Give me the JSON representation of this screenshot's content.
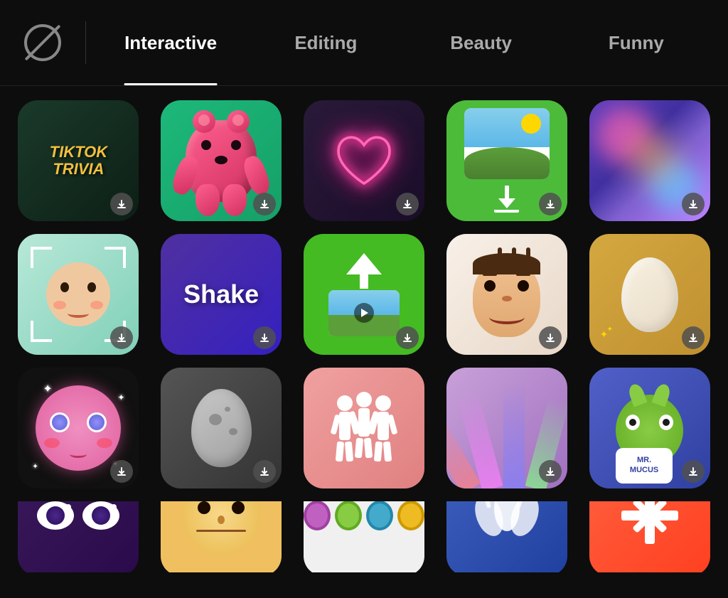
{
  "tabs": [
    {
      "id": "none",
      "label": "None",
      "icon": "no-filter",
      "active": false
    },
    {
      "id": "interactive",
      "label": "Interactive",
      "active": true
    },
    {
      "id": "editing",
      "label": "Editing",
      "active": false
    },
    {
      "id": "beauty",
      "label": "Beauty",
      "active": false
    },
    {
      "id": "funny",
      "label": "Funny",
      "active": false
    }
  ],
  "apps": {
    "row1": [
      {
        "id": "tiktok-trivia",
        "name": "TikTok Trivia",
        "hasDownload": true
      },
      {
        "id": "gummy-bear",
        "name": "Gummy Bear",
        "hasDownload": true
      },
      {
        "id": "neon-heart",
        "name": "Neon Heart",
        "hasDownload": true
      },
      {
        "id": "photo-download",
        "name": "Photo Download",
        "hasDownload": true
      },
      {
        "id": "abstract-gradient",
        "name": "Abstract Gradient",
        "hasDownload": true
      }
    ],
    "row2": [
      {
        "id": "face-scan",
        "name": "Face Scan",
        "hasDownload": true
      },
      {
        "id": "shake",
        "name": "Shake",
        "hasDownload": true
      },
      {
        "id": "upload-video",
        "name": "Upload Video",
        "hasDownload": true
      },
      {
        "id": "face-character",
        "name": "Face Character",
        "hasDownload": true
      },
      {
        "id": "egg",
        "name": "Egg",
        "hasDownload": true
      }
    ],
    "row3": [
      {
        "id": "dreamy-face",
        "name": "Dreamy Face",
        "hasDownload": true
      },
      {
        "id": "gray-egg",
        "name": "Gray Egg",
        "hasDownload": true
      },
      {
        "id": "dance-silhouette",
        "name": "Dance Silhouette",
        "hasDownload": false
      },
      {
        "id": "light-beams",
        "name": "Light Beams",
        "hasDownload": true
      },
      {
        "id": "mr-mucus",
        "name": "Mr. Mucus",
        "hasDownload": true
      }
    ],
    "row4": [
      {
        "id": "big-eyes",
        "name": "Big Eyes",
        "hasDownload": false
      },
      {
        "id": "round-face",
        "name": "Round Face",
        "hasDownload": false
      },
      {
        "id": "color-circles",
        "name": "Color Circles",
        "hasDownload": false
      },
      {
        "id": "wave-hands",
        "name": "Wave Hands",
        "hasDownload": false
      },
      {
        "id": "sparkle-app",
        "name": "Sparkle App",
        "hasDownload": false
      }
    ]
  },
  "tiktok_trivia_text": "TIKTOK\nTRIVIA",
  "shake_text": "Shake",
  "mr_mucus_text": "MR.\nMUCUS"
}
